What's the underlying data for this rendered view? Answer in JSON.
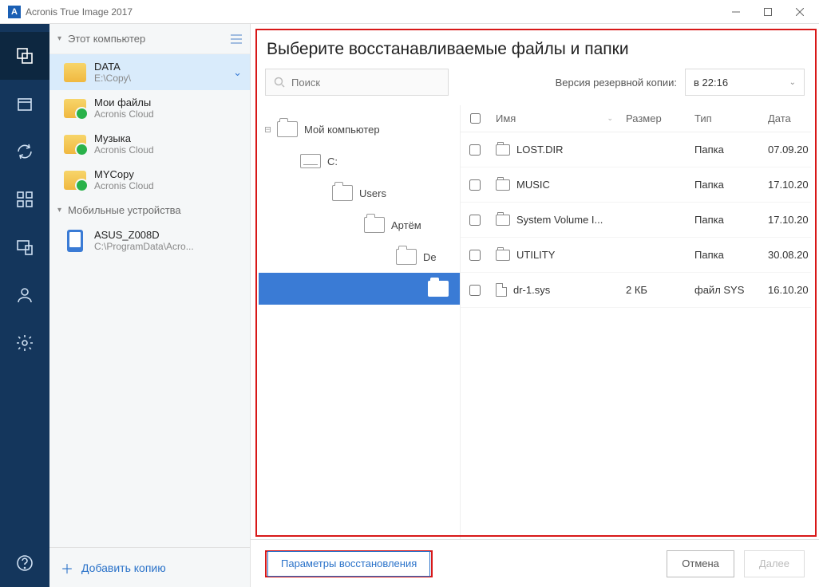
{
  "window": {
    "title": "Acronis True Image 2017"
  },
  "sidebar": {
    "header": "Этот компьютер",
    "items": [
      {
        "name": "DATA",
        "sub": "E:\\Copy\\"
      },
      {
        "name": "Мои файлы",
        "sub": "Acronis Cloud"
      },
      {
        "name": "Музыка",
        "sub": "Acronis Cloud"
      },
      {
        "name": "MYCopy",
        "sub": "Acronis Cloud"
      }
    ],
    "section2": "Мобильные устройства",
    "mobile": [
      {
        "name": "ASUS_Z008D",
        "sub": "C:\\ProgramData\\Acro..."
      }
    ],
    "add": "Добавить копию"
  },
  "content": {
    "title": "Выберите восстанавливаемые файлы и папки",
    "search_placeholder": "Поиск",
    "version_label": "Версия резервной копии:",
    "version_value": "в 22:16",
    "tree": [
      {
        "label": "Мой компьютер",
        "indent": 0,
        "type": "folder",
        "dash": true
      },
      {
        "label": "C:",
        "indent": 1,
        "type": "drive"
      },
      {
        "label": "Users",
        "indent": 2,
        "type": "folder"
      },
      {
        "label": "Артём",
        "indent": 3,
        "type": "folder"
      },
      {
        "label": "De",
        "indent": 4,
        "type": "folder"
      },
      {
        "label": "",
        "indent": 5,
        "type": "folder",
        "selected": true
      }
    ],
    "columns": {
      "name": "Имя",
      "size": "Размер",
      "type": "Тип",
      "date": "Дата"
    },
    "files": [
      {
        "name": "LOST.DIR",
        "size": "",
        "type": "Папка",
        "date": "07.09.20",
        "icon": "folder"
      },
      {
        "name": "MUSIC",
        "size": "",
        "type": "Папка",
        "date": "17.10.20",
        "icon": "folder"
      },
      {
        "name": "System Volume I...",
        "size": "",
        "type": "Папка",
        "date": "17.10.20",
        "icon": "folder"
      },
      {
        "name": "UTILITY",
        "size": "",
        "type": "Папка",
        "date": "30.08.20",
        "icon": "folder"
      },
      {
        "name": "dr-1.sys",
        "size": "2 КБ",
        "type": "файл SYS",
        "date": "16.10.20",
        "icon": "file"
      }
    ],
    "footer": {
      "params": "Параметры восстановления",
      "cancel": "Отмена",
      "next": "Далее"
    }
  }
}
